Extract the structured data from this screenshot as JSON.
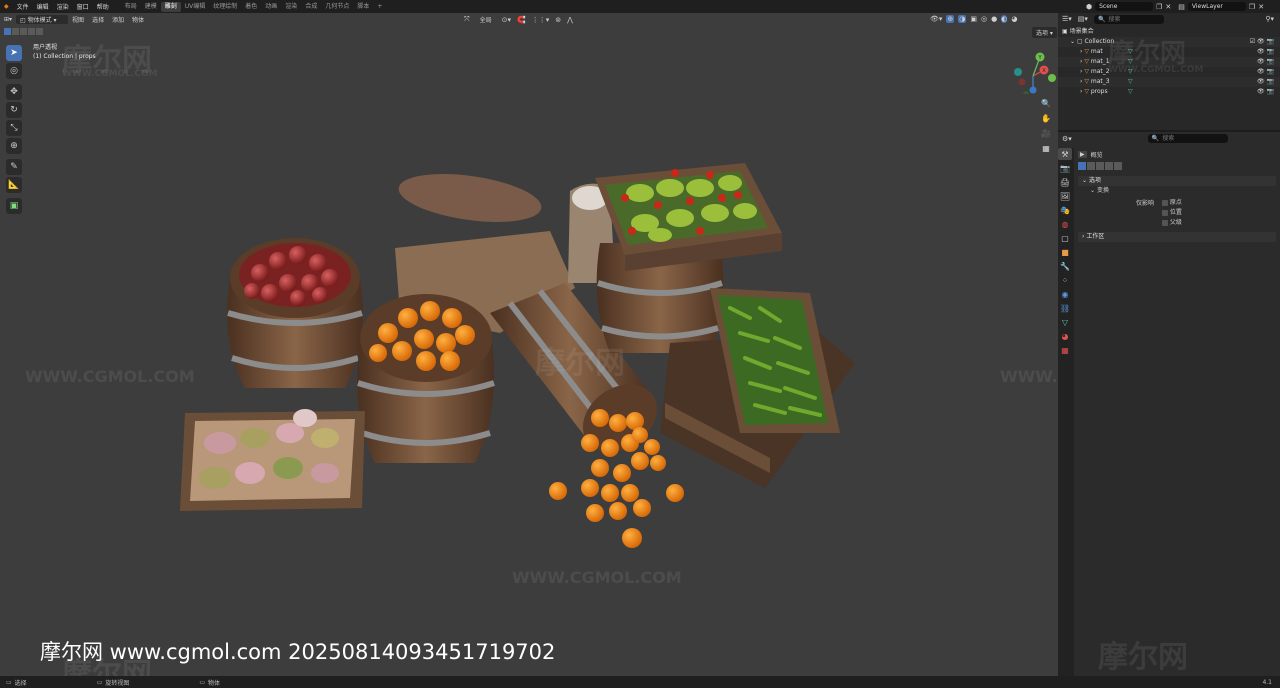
{
  "menubar": {
    "menus": [
      "文件",
      "编辑",
      "渲染",
      "窗口",
      "帮助"
    ],
    "workspaces": [
      "布局",
      "建模",
      "雕刻",
      "UV编辑",
      "纹理绘制",
      "着色",
      "动画",
      "渲染",
      "合成",
      "几何节点",
      "脚本"
    ],
    "active_workspace": "雕刻",
    "add_tab": "+",
    "scene_name": "Scene",
    "view_layer": "ViewLayer"
  },
  "viewport": {
    "mode": "物体模式",
    "menus": [
      "视图",
      "选择",
      "添加",
      "物体"
    ],
    "transform_orientation": "全局",
    "options_label": "选项",
    "view_name": "用户透视",
    "collection_info": "(1) Collection | props",
    "gizmo_axes": {
      "x": "X",
      "y": "Y",
      "z": "Z"
    }
  },
  "watermarks": {
    "logo": "摩尔网",
    "site": "WWW.CGMOL.COM"
  },
  "footer_watermark": "摩尔网 www.cgmol.com 20250814093451719702",
  "outliner": {
    "title": "场景集合",
    "search_placeholder": "搜索",
    "collection": "Collection",
    "objects": [
      "mat",
      "mat_1",
      "mat_2",
      "mat_3",
      "props"
    ]
  },
  "properties": {
    "search_placeholder": "搜索",
    "section_title": "概览",
    "panel_options": "选项",
    "panel_transform": "变换",
    "affect_only": "仅影响",
    "checkbox_origins": "原点",
    "checkbox_locations": "位置",
    "checkbox_parents": "父级",
    "panel_workspace": "工作区"
  },
  "statusbar": {
    "select": "选择",
    "rotate_view": "旋转视图",
    "object": "物体",
    "version": "4.1"
  },
  "colors": {
    "accent": "#4772b3",
    "viewport_bg": "#3d3d3d",
    "panel_bg": "#2b2b2b"
  }
}
